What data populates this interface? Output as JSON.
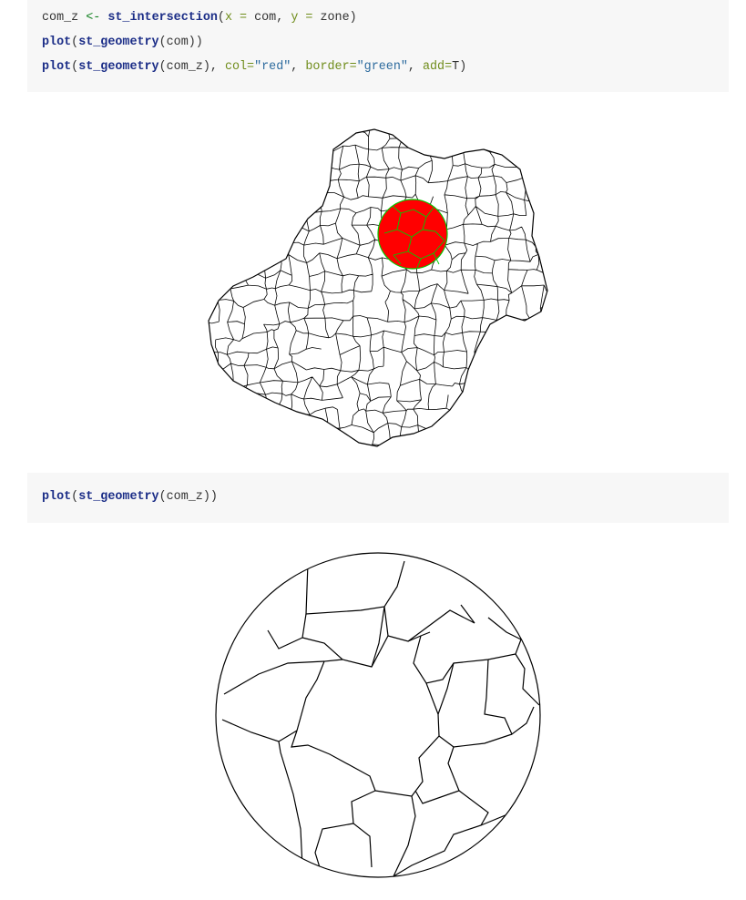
{
  "code_block_1": {
    "line_1": {
      "target": "com_z",
      "assign": "<-",
      "fn": "st_intersection",
      "open": "(",
      "arg_x": "x =",
      "val_x": "com",
      "sep": ",",
      "arg_y": "y =",
      "val_y": "zone",
      "close": ")"
    },
    "line_2": {
      "fn_plot": "plot",
      "open": "(",
      "fn_geom": "st_geometry",
      "rest": "(com))"
    },
    "line_3": {
      "fn_plot": "plot",
      "open": "(",
      "fn_geom": "st_geometry",
      "mid": "(com_z),",
      "arg_col": "col=",
      "val_col": "\"red\"",
      "sep1": ",",
      "arg_border": "border=",
      "val_border": "\"green\"",
      "sep2": ",",
      "arg_add": "add=",
      "val_add": "T",
      "close": ")"
    }
  },
  "code_block_2": {
    "line_1": {
      "fn_plot": "plot",
      "open": "(",
      "fn_geom": "st_geometry",
      "rest": "(com_z))"
    }
  },
  "plots": {
    "map_all_communes": {
      "fill": "#ffffff",
      "stroke": "#000000"
    },
    "intersection_overlay": {
      "fill": "#ff0000",
      "border": "#00cc00"
    },
    "map_intersection": {
      "fill": "#ffffff",
      "stroke": "#000000"
    }
  }
}
